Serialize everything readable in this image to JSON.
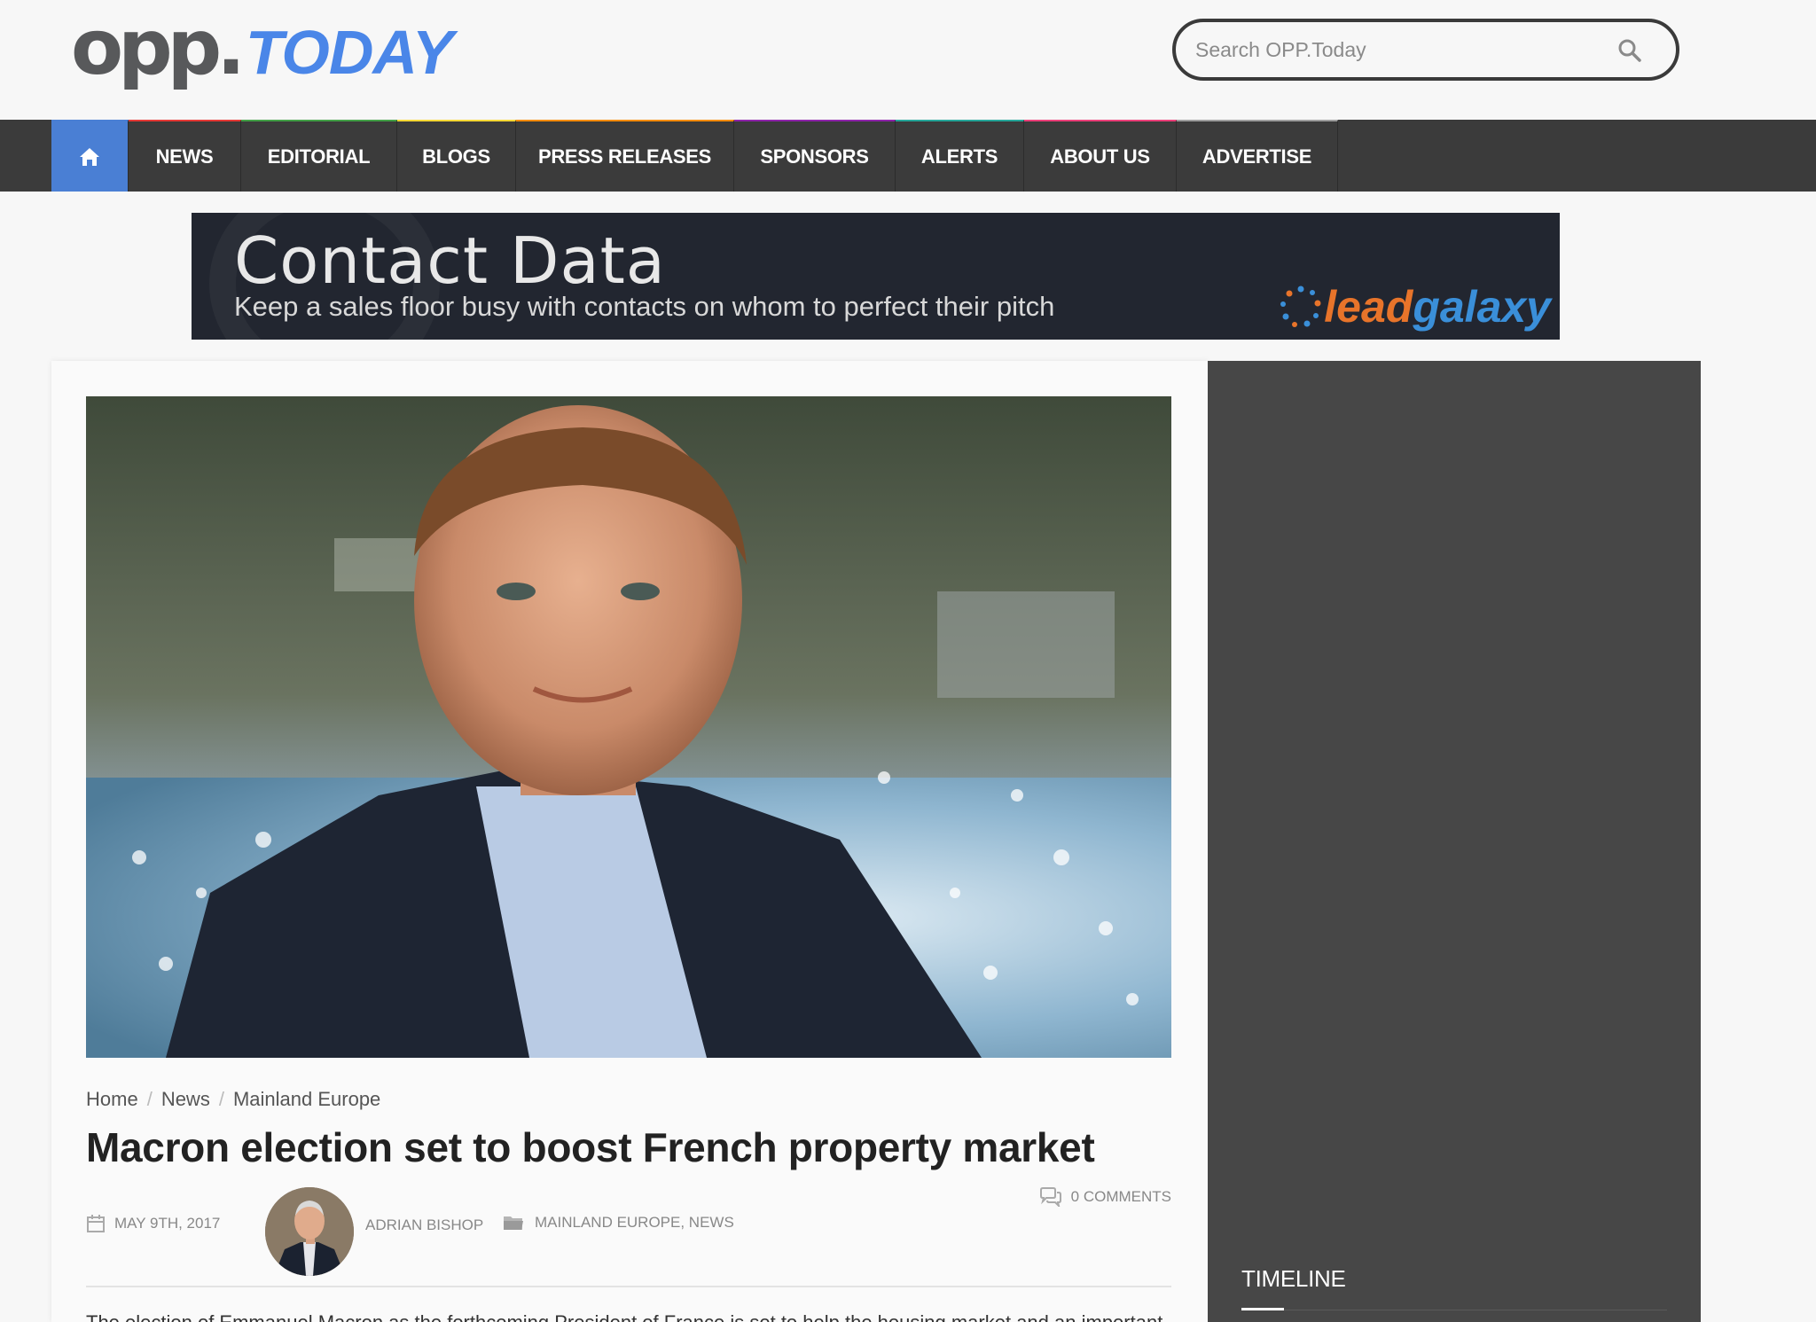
{
  "header": {
    "logo_main": "opp",
    "logo_dot": ".",
    "logo_accent": "TODAY",
    "search_placeholder": "Search OPP.Today",
    "search_icon": "search-icon"
  },
  "nav": {
    "home_icon": "home-icon",
    "items": [
      {
        "label": "NEWS",
        "accent": "#e53935"
      },
      {
        "label": "EDITORIAL",
        "accent": "#43a047"
      },
      {
        "label": "BLOGS",
        "accent": "#fdd835"
      },
      {
        "label": "PRESS RELEASES",
        "accent": "#fb8c00"
      },
      {
        "label": "SPONSORS",
        "accent": "#8e24aa"
      },
      {
        "label": "ALERTS",
        "accent": "#26a69a"
      },
      {
        "label": "ABOUT US",
        "accent": "#ec407a"
      },
      {
        "label": "ADVERTISE",
        "accent": "#9e9e9e"
      }
    ]
  },
  "banner": {
    "title": "Contact Data",
    "subtitle": "Keep a sales floor busy with contacts on whom to perfect their pitch",
    "logo_lead": "lead",
    "logo_galaxy": "galaxy"
  },
  "article": {
    "breadcrumb": [
      "Home",
      "News",
      "Mainland Europe"
    ],
    "title": "Macron election set to boost French property market",
    "date": "MAY 9TH, 2017",
    "author": "ADRIAN BISHOP",
    "categories": "MAINLAND EUROPE, NEWS",
    "comments": "0 COMMENTS",
    "body_first_line": "The election of Emmanuel Macron as the forthcoming President of France is set to help the housing market and an important"
  },
  "sidebar": {
    "title": "TIMELINE"
  },
  "colors": {
    "accent_blue": "#4a86e8",
    "nav_bg": "#3b3b3b",
    "home_bg": "#4a7fd4",
    "sidebar_bg": "#474747"
  }
}
